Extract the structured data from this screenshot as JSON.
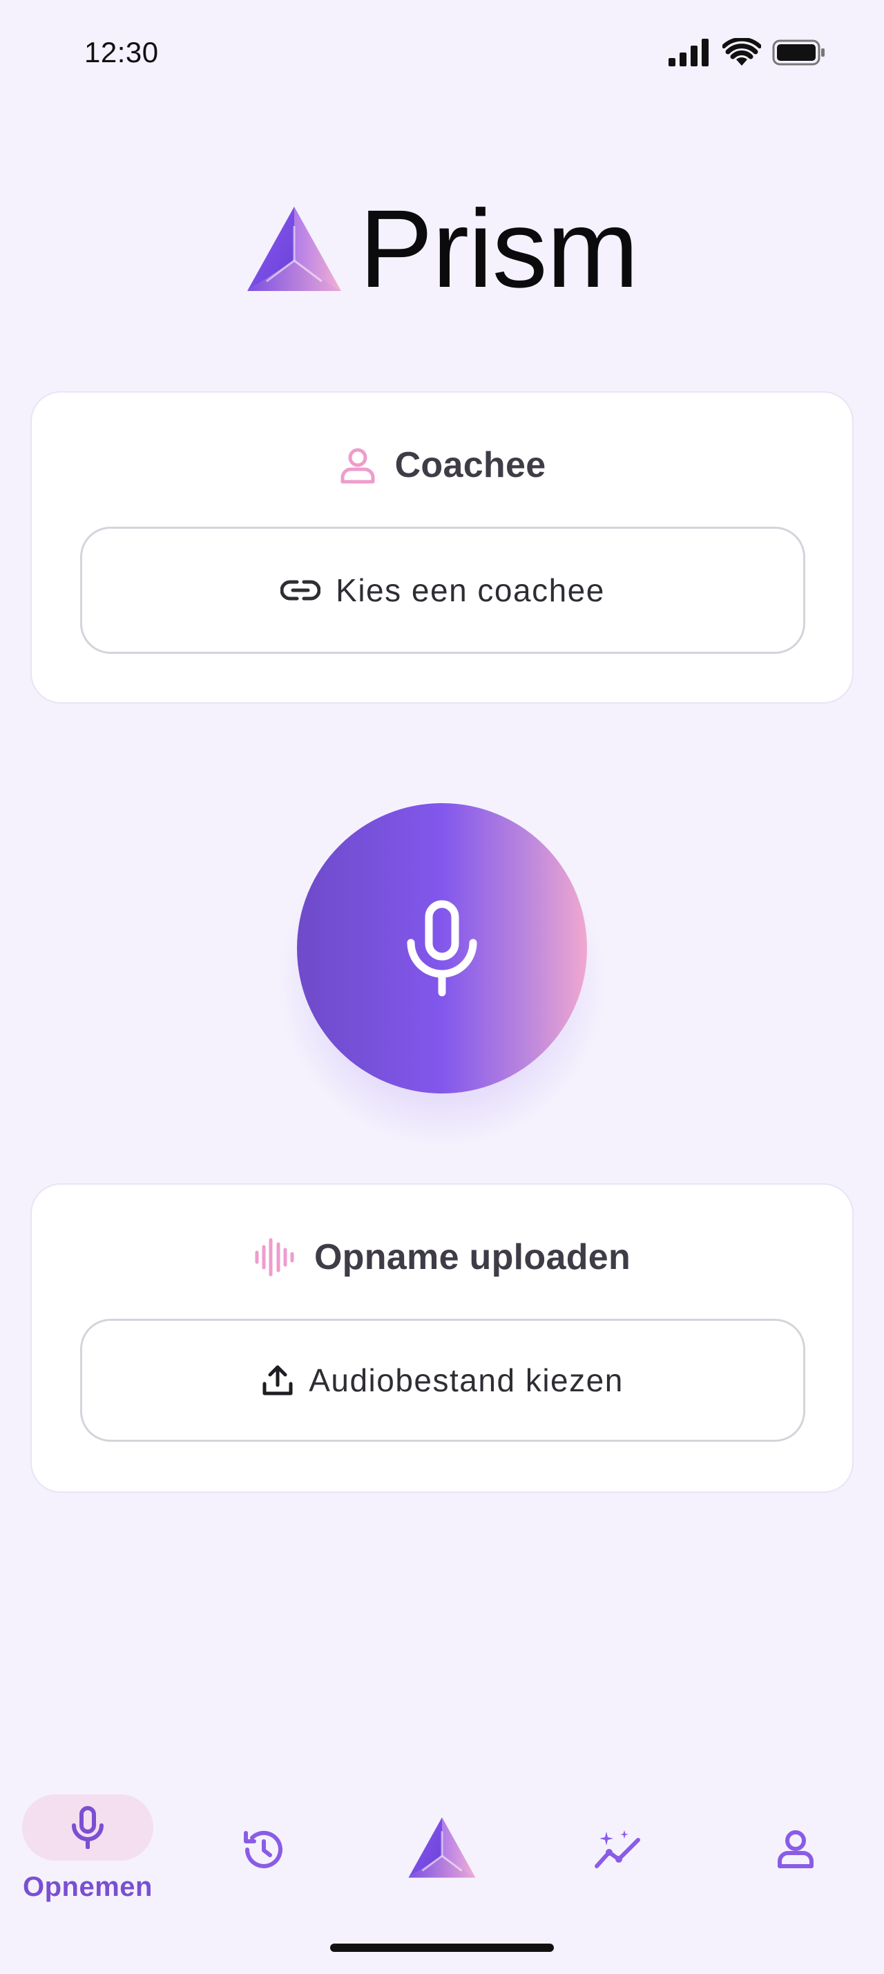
{
  "status_bar": {
    "time": "12:30"
  },
  "brand": {
    "name": "Prism"
  },
  "coachee_card": {
    "title": "Coachee",
    "button_label": "Kies een coachee"
  },
  "record": {
    "icon": "microphone-icon"
  },
  "upload_card": {
    "title": "Opname uploaden",
    "button_label": "Audiobestand kiezen"
  },
  "bottom_nav": {
    "items": [
      {
        "label": "Opnemen",
        "icon": "microphone-icon",
        "active": true
      },
      {
        "icon": "history-icon"
      },
      {
        "icon": "prism-logo-icon"
      },
      {
        "icon": "insights-icon"
      },
      {
        "icon": "profile-icon"
      }
    ]
  },
  "colors": {
    "accent": "#7a4fd0",
    "accent_pink": "#ee9ccc",
    "background": "#f5f2fd",
    "active_pill": "#f4dff0"
  }
}
